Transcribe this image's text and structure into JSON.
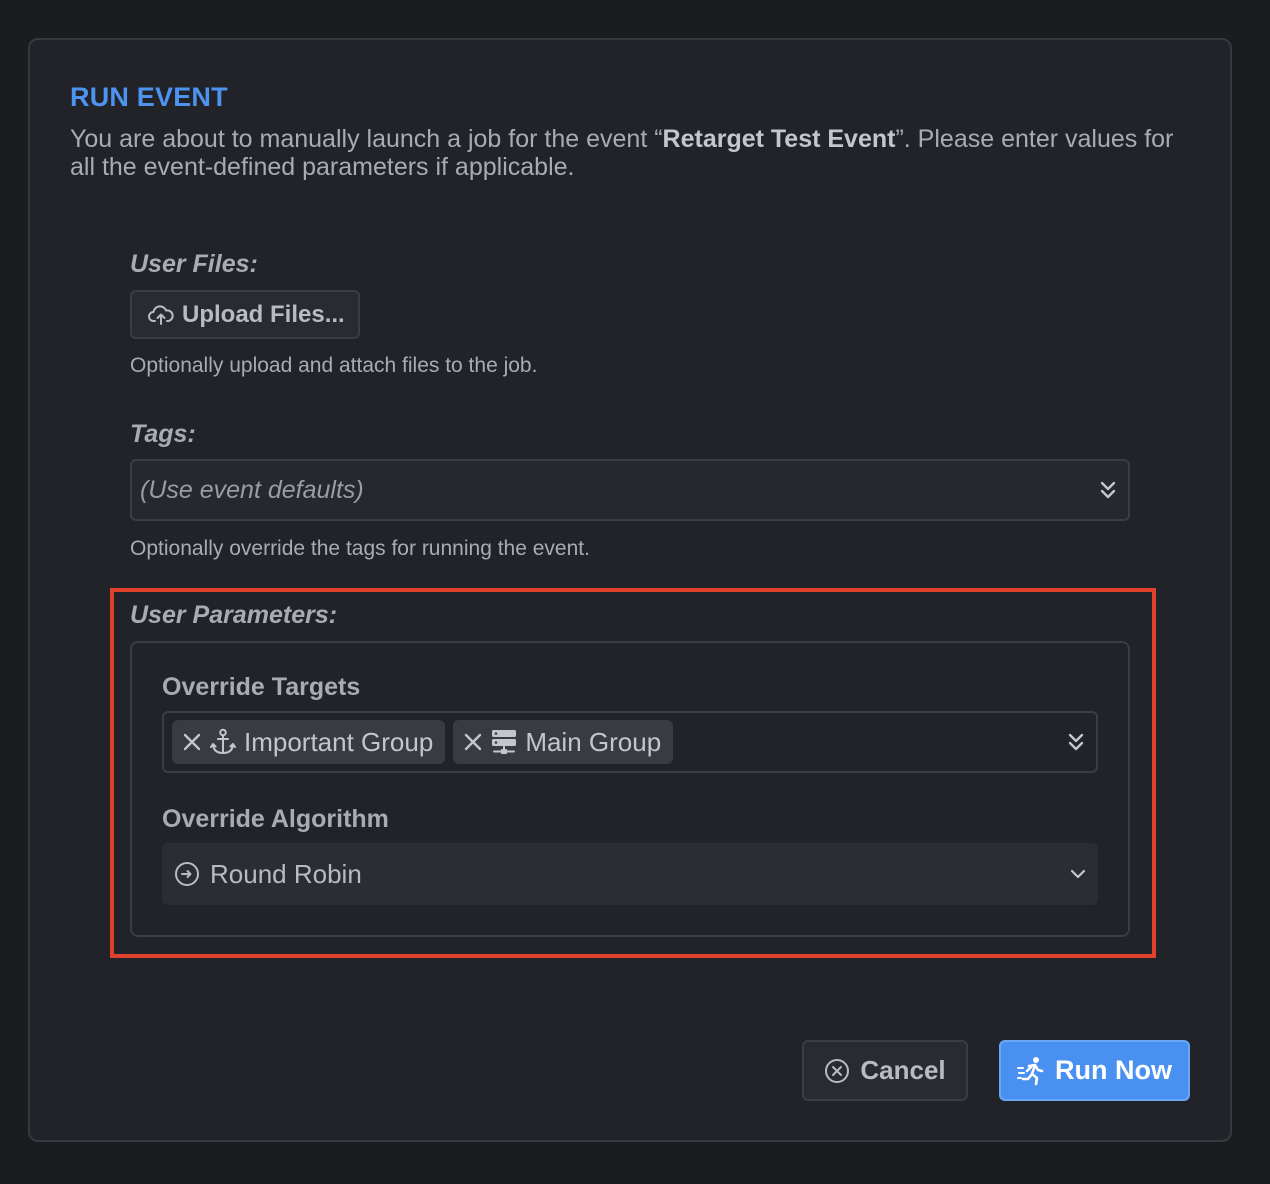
{
  "dialog": {
    "title": "RUN EVENT",
    "intro_before": "You are about to manually launch a job for the event “",
    "event_name": "Retarget Test Event",
    "intro_after": "”. Please enter values for all the event-defined parameters if applicable."
  },
  "user_files": {
    "label": "User Files:",
    "button_label": "Upload Files...",
    "button_icon": "cloud-upload-icon",
    "help": "Optionally upload and attach files to the job."
  },
  "tags": {
    "label": "Tags:",
    "placeholder": "(Use event defaults)",
    "help": "Optionally override the tags for running the event."
  },
  "user_parameters": {
    "label": "User Parameters:",
    "override_targets": {
      "label": "Override Targets",
      "chips": [
        {
          "label": "Important Group",
          "icon": "anchor-icon"
        },
        {
          "label": "Main Group",
          "icon": "server-icon"
        }
      ]
    },
    "override_algorithm": {
      "label": "Override Algorithm",
      "value": "Round Robin",
      "icon": "round-robin-icon"
    }
  },
  "actions": {
    "cancel_label": "Cancel",
    "run_label": "Run Now"
  },
  "colors": {
    "accent": "#4a90f0",
    "highlight": "#e0412c",
    "background": "#1b1c20"
  }
}
